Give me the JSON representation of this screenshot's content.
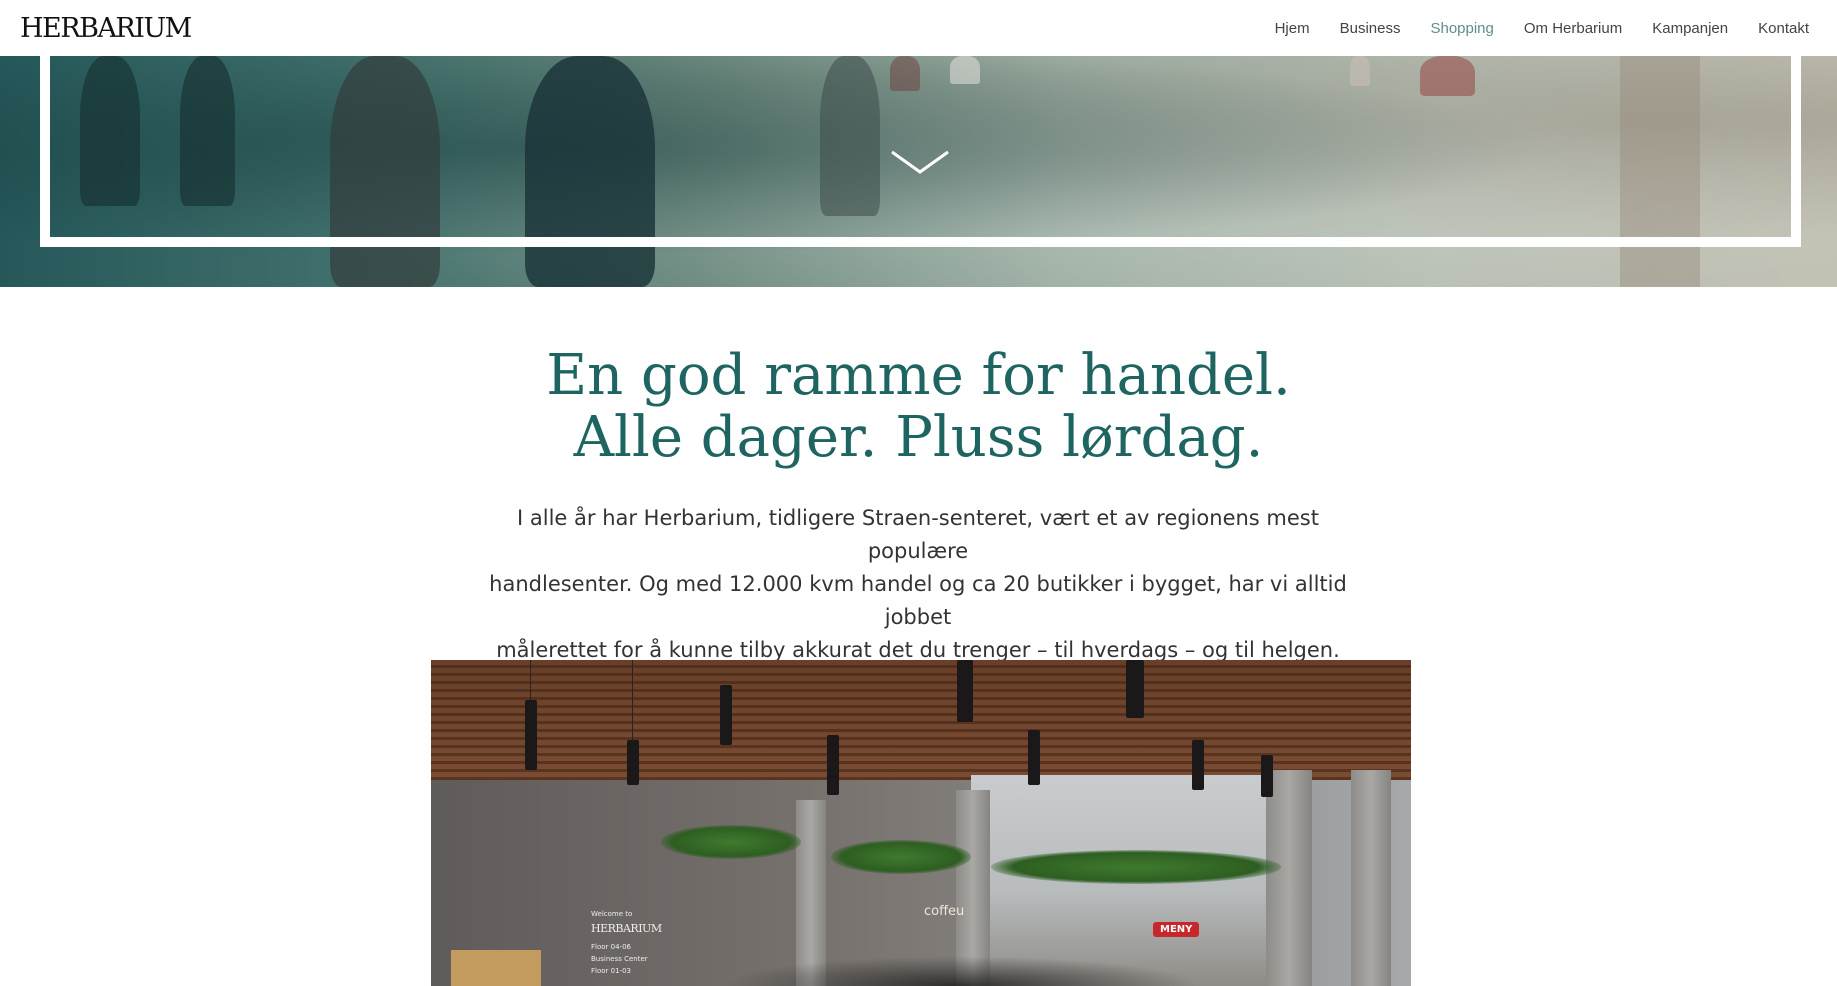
{
  "header": {
    "logo": "HERBARIUM",
    "nav": [
      {
        "label": "Hjem",
        "active": false
      },
      {
        "label": "Business",
        "active": false
      },
      {
        "label": "Shopping",
        "active": true
      },
      {
        "label": "Om Herbarium",
        "active": false
      },
      {
        "label": "Kampanjen",
        "active": false
      },
      {
        "label": "Kontakt",
        "active": false
      }
    ]
  },
  "hero": {
    "scroll_icon": "chevron-down-icon"
  },
  "main": {
    "headline_line1": "En god ramme for handel.",
    "headline_line2": "Alle dager. Pluss lørdag.",
    "intro_line1": "I alle år har Herbarium, tidligere Straen-senteret, vært et av regionens mest populære",
    "intro_line2": "handlesenter. Og med 12.000 kvm handel og ca 20 butikker i bygget, har vi alltid jobbet",
    "intro_line3": "målerettet for å kunne tilby akkurat det du trenger – til hverdags – og til helgen."
  },
  "photo": {
    "sign_welcome": "Welcome to",
    "sign_logo": "HERBARIUM",
    "sign_floor1": "Floor 04-06",
    "sign_floor1_desc": "Business Center",
    "sign_floor2": "Floor 01-03",
    "coffee": "coffeu",
    "meny": "MENY"
  },
  "colors": {
    "accent_teal": "#1e6461",
    "nav_active": "#5e8e89"
  }
}
